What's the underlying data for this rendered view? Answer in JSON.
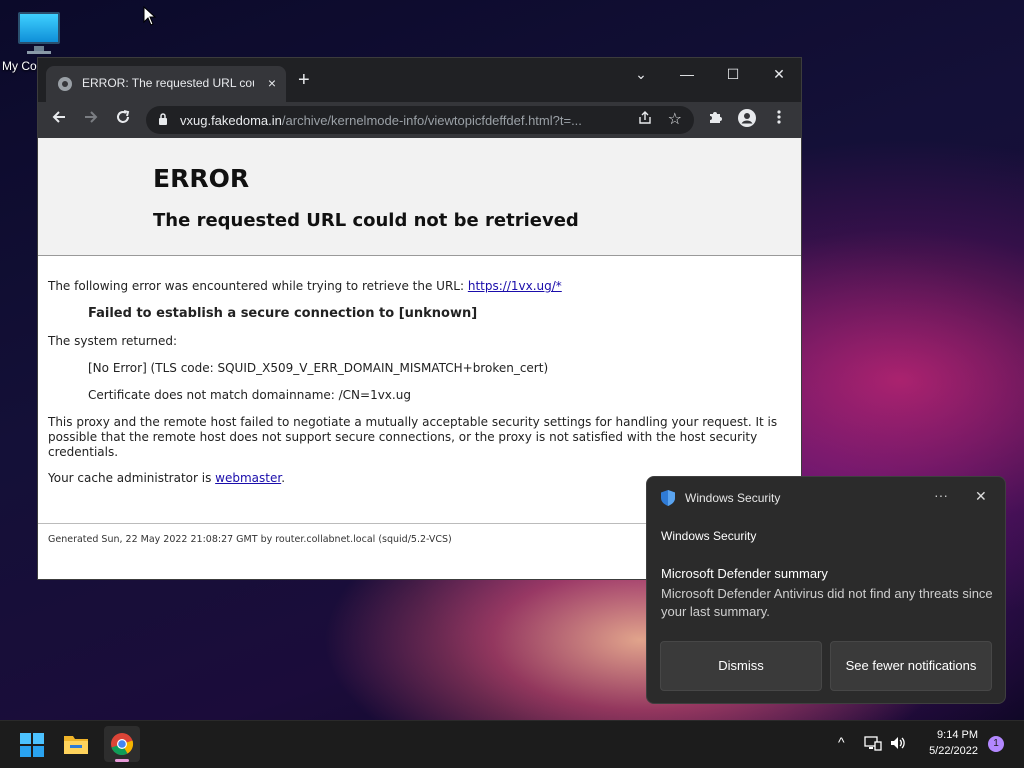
{
  "desktop": {
    "icon_label": "My Co"
  },
  "browser": {
    "tab_title": "ERROR: The requested URL could not be retrieved",
    "tab_close": "×",
    "new_tab": "+",
    "url_host": "vxug.fakedoma.in",
    "url_path": "/archive/kernelmode-info/viewtopicfdeffdef.html?t=...",
    "controls": {
      "dropdown": "⌄",
      "minimize": "—",
      "maximize": "☐",
      "close": "✕"
    }
  },
  "page": {
    "title": "ERROR",
    "subtitle": "The requested URL could not be retrieved",
    "intro": "The following error was encountered while trying to retrieve the URL: ",
    "intro_link": "https://1vx.ug/*",
    "failed": "Failed to establish a secure connection to [unknown]",
    "system_returned": "The system returned:",
    "no_error": "[No Error] (TLS code: SQUID_X509_V_ERR_DOMAIN_MISMATCH+broken_cert)",
    "cert_mismatch": "Certificate does not match domainname: /CN=1vx.ug",
    "explanation": "This proxy and the remote host failed to negotiate a mutually acceptable security settings for handling your request. It is possible that the remote host does not support secure connections, or the proxy is not satisfied with the host security credentials.",
    "cache_admin": "Your cache administrator is ",
    "cache_admin_link": "webmaster",
    "cache_admin_end": ".",
    "footer": "Generated Sun, 22 May 2022 21:08:27 GMT by router.collabnet.local (squid/5.2-VCS)"
  },
  "notification": {
    "app_name": "Windows Security",
    "more": "···",
    "close": "✕",
    "sub_title": "Windows Security",
    "heading": "Microsoft Defender summary",
    "body": "Microsoft Defender Antivirus did not find any threats since your last summary.",
    "dismiss": "Dismiss",
    "fewer": "See fewer notifications"
  },
  "taskbar": {
    "time": "9:14 PM",
    "date": "5/22/2022",
    "notification_count": "1",
    "chevron": "^"
  }
}
